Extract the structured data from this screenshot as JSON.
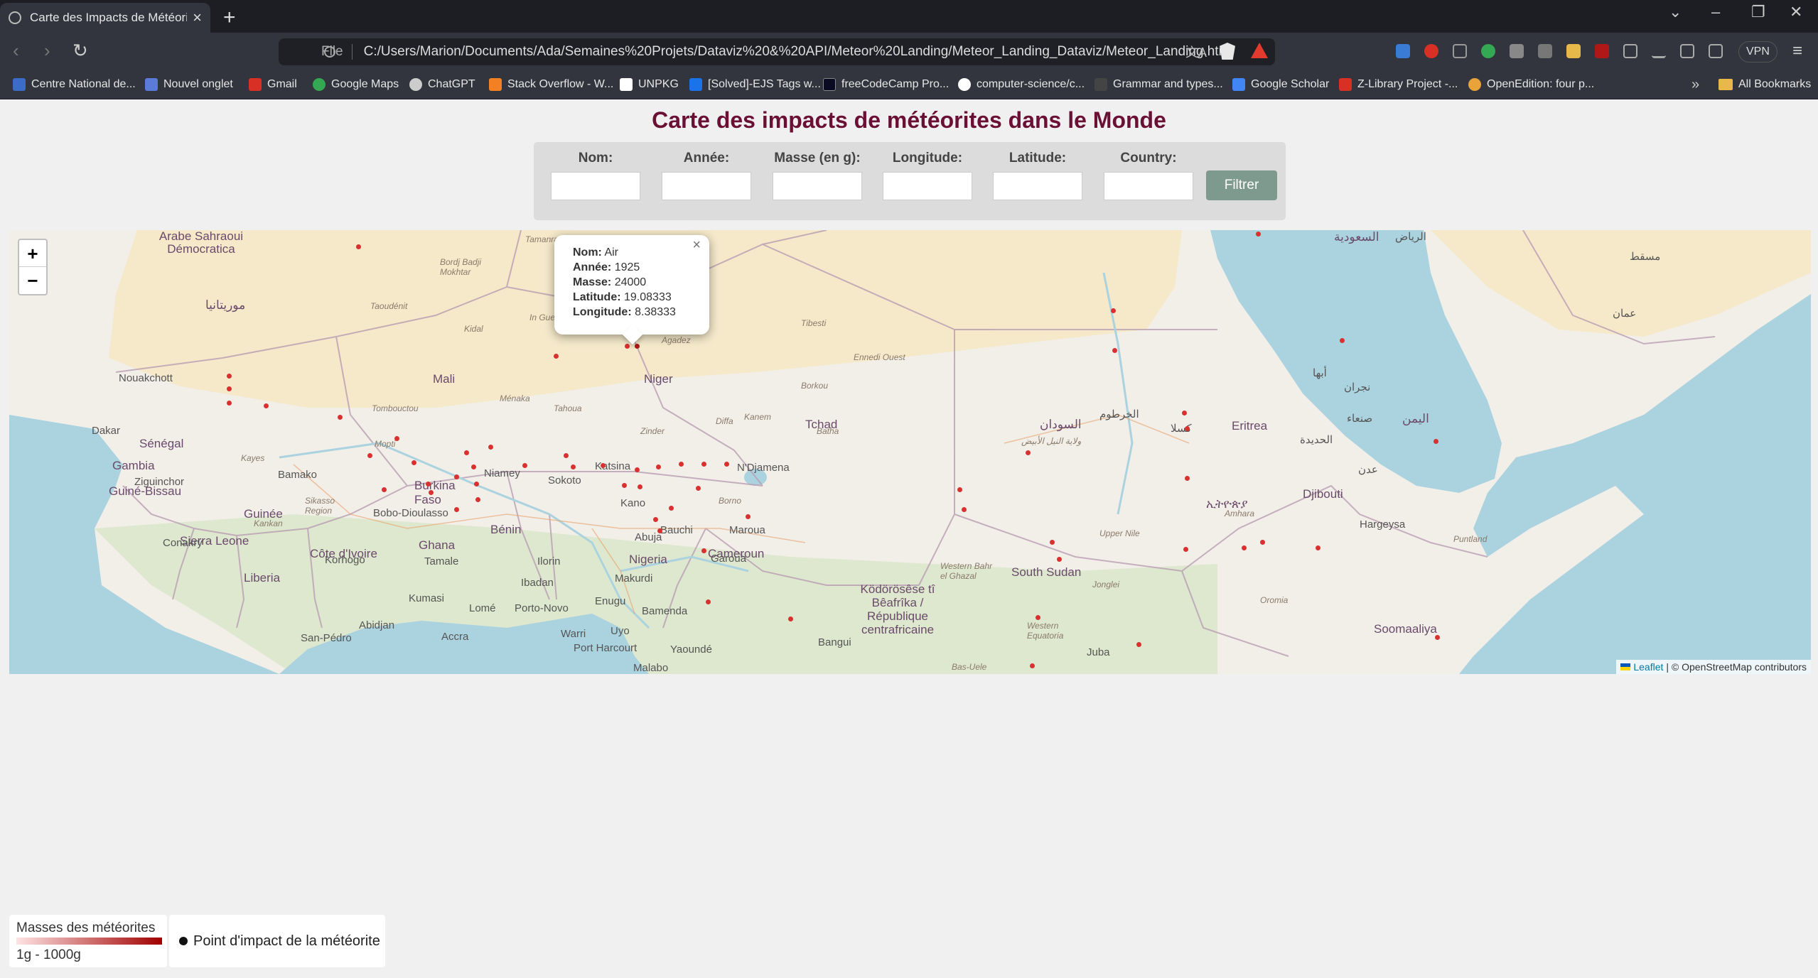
{
  "browser": {
    "tab_title": "Carte des Impacts de Météorite",
    "url_scheme": "File",
    "url": "C:/Users/Marion/Documents/Ada/Semaines%20Projets/Dataviz%20&%20API/Meteor%20Landing/Meteor_Landing_Dataviz/Meteor_Landing.html",
    "vpn_label": "VPN",
    "bookmarks": [
      {
        "label": "Centre National de...",
        "color": "#3a6cc8"
      },
      {
        "label": "Nouvel onglet",
        "color": "#5a7bd8"
      },
      {
        "label": "Gmail",
        "color": "#d93025"
      },
      {
        "label": "Google Maps",
        "color": "#34a853"
      },
      {
        "label": "ChatGPT",
        "color": "#cccccc"
      },
      {
        "label": "Stack Overflow - W...",
        "color": "#f48024"
      },
      {
        "label": "UNPKG",
        "color": "#ffffff"
      },
      {
        "label": "[Solved]-EJS Tags w...",
        "color": "#1a73e8"
      },
      {
        "label": "freeCodeCamp Pro...",
        "color": "#0a0a23"
      },
      {
        "label": "computer-science/c...",
        "color": "#ffffff"
      },
      {
        "label": "Grammar and types...",
        "color": "#444444"
      },
      {
        "label": "Google Scholar",
        "color": "#4285f4"
      },
      {
        "label": "Z-Library Project -...",
        "color": "#d93025"
      },
      {
        "label": "OpenEdition: four p...",
        "color": "#e8a33a"
      }
    ],
    "all_bookmarks": "All Bookmarks"
  },
  "page": {
    "title": "Carte des impacts de météorites dans le Monde",
    "filters": [
      {
        "label": "Nom:",
        "value": ""
      },
      {
        "label": "Année:",
        "value": ""
      },
      {
        "label": "Masse (en g):",
        "value": ""
      },
      {
        "label": "Longitude:",
        "value": ""
      },
      {
        "label": "Latitude:",
        "value": ""
      },
      {
        "label": "Country:",
        "value": ""
      }
    ],
    "filter_button": "Filtrer"
  },
  "map": {
    "zoom_in": "+",
    "zoom_out": "−",
    "popup": {
      "close": "×",
      "nom_label": "Nom:",
      "nom": "Air",
      "annee_label": "Année:",
      "annee": "1925",
      "masse_label": "Masse:",
      "masse": "24000",
      "latitude_label": "Latitude:",
      "latitude": "19.08333",
      "longitude_label": "Longitude:",
      "longitude": "8.38333"
    },
    "attribution_link": "Leaflet",
    "attribution_text": "| © OpenStreetMap contributors",
    "labels": [
      {
        "text": "Mali",
        "kind": "country"
      },
      {
        "text": "Niger",
        "kind": "country"
      },
      {
        "text": "Tchad",
        "kind": "country"
      },
      {
        "text": "Nigeria",
        "kind": "country"
      },
      {
        "text": "Sénégal",
        "kind": "country"
      },
      {
        "text": "Gambia",
        "kind": "country"
      },
      {
        "text": "Guinée",
        "kind": "country"
      },
      {
        "text": "Guiné-Bissau",
        "kind": "country"
      },
      {
        "text": "Sierra Leone",
        "kind": "country"
      },
      {
        "text": "Liberia",
        "kind": "country"
      },
      {
        "text": "Côte d'Ivoire",
        "kind": "country"
      },
      {
        "text": "Ghana",
        "kind": "country"
      },
      {
        "text": "Burkina Faso",
        "kind": "country"
      },
      {
        "text": "Bénin",
        "kind": "country"
      },
      {
        "text": "Cameroun",
        "kind": "country"
      },
      {
        "text": "Ködörösêse tî Bêafrîka / République centrafricaine",
        "kind": "country"
      },
      {
        "text": "South Sudan",
        "kind": "country"
      },
      {
        "text": "السودان",
        "kind": "country"
      },
      {
        "text": "Eritrea",
        "kind": "country"
      },
      {
        "text": "Djibouti",
        "kind": "country"
      },
      {
        "text": "Soomaaliya",
        "kind": "country"
      },
      {
        "text": "اليمن",
        "kind": "country"
      },
      {
        "text": "Arabe Sahraoui Démocratica",
        "kind": "country"
      },
      {
        "text": "Dakar",
        "kind": "city"
      },
      {
        "text": "Bamako",
        "kind": "city"
      },
      {
        "text": "Niamey",
        "kind": "city"
      },
      {
        "text": "Kano",
        "kind": "city"
      },
      {
        "text": "Katsina",
        "kind": "city"
      },
      {
        "text": "Sokoto",
        "kind": "city"
      },
      {
        "text": "Bauchi",
        "kind": "city"
      },
      {
        "text": "Maroua",
        "kind": "city"
      },
      {
        "text": "Garoua",
        "kind": "city"
      },
      {
        "text": "N'Djamena",
        "kind": "city"
      },
      {
        "text": "Abuja",
        "kind": "city"
      },
      {
        "text": "Makurdi",
        "kind": "city"
      },
      {
        "text": "Enugu",
        "kind": "city"
      },
      {
        "text": "Uyo",
        "kind": "city"
      },
      {
        "text": "Warri",
        "kind": "city"
      },
      {
        "text": "Port Harcourt",
        "kind": "city"
      },
      {
        "text": "Yaoundé",
        "kind": "city"
      },
      {
        "text": "Bamenda",
        "kind": "city"
      },
      {
        "text": "Bangui",
        "kind": "city"
      },
      {
        "text": "Ibadan",
        "kind": "city"
      },
      {
        "text": "Ilorin",
        "kind": "city"
      },
      {
        "text": "Lomé",
        "kind": "city"
      },
      {
        "text": "Porto-Novo",
        "kind": "city"
      },
      {
        "text": "Accra",
        "kind": "city"
      },
      {
        "text": "Kumasi",
        "kind": "city"
      },
      {
        "text": "Tamale",
        "kind": "city"
      },
      {
        "text": "Abidjan",
        "kind": "city"
      },
      {
        "text": "San-Pédro",
        "kind": "city"
      },
      {
        "text": "Korhogo",
        "kind": "city"
      },
      {
        "text": "Bobo-Dioulasso",
        "kind": "city"
      },
      {
        "text": "Conakry",
        "kind": "city"
      },
      {
        "text": "Ziguinchor",
        "kind": "city"
      },
      {
        "text": "Tombouctou",
        "kind": "city"
      },
      {
        "text": "Agadez",
        "kind": "city"
      },
      {
        "text": "Tahoua",
        "kind": "city"
      },
      {
        "text": "Ménaka",
        "kind": "city"
      },
      {
        "text": "Zinder",
        "kind": "city"
      },
      {
        "text": "Diffa",
        "kind": "city"
      },
      {
        "text": "Kidal",
        "kind": "city"
      },
      {
        "text": "Taoudénit",
        "kind": "city"
      },
      {
        "text": "Tamanrasset",
        "kind": "city"
      },
      {
        "text": "Juba",
        "kind": "city"
      },
      {
        "text": "Hargeysa",
        "kind": "city"
      },
      {
        "text": "الخرطوم",
        "kind": "city"
      },
      {
        "text": "كسلا",
        "kind": "city"
      },
      {
        "text": "صنعاء",
        "kind": "city"
      },
      {
        "text": "عدن",
        "kind": "city"
      },
      {
        "text": "الرياض",
        "kind": "city"
      },
      {
        "text": "مسقط",
        "kind": "city"
      },
      {
        "text": "عمان",
        "kind": "city"
      },
      {
        "text": "السعودية",
        "kind": "country"
      },
      {
        "text": "أبها",
        "kind": "city"
      },
      {
        "text": "نجران",
        "kind": "city"
      },
      {
        "text": "الحديدة",
        "kind": "city"
      },
      {
        "text": "Tibesti",
        "kind": "region"
      },
      {
        "text": "Ennedi Ouest",
        "kind": "region"
      },
      {
        "text": "Borkou",
        "kind": "region"
      },
      {
        "text": "Kanem",
        "kind": "region"
      },
      {
        "text": "Batha",
        "kind": "region"
      },
      {
        "text": "Bordj Badji Mokhtar",
        "kind": "region"
      },
      {
        "text": "In Guezzam",
        "kind": "region"
      },
      {
        "text": "Western Bahr el Ghazal",
        "kind": "region"
      },
      {
        "text": "Upper Nile",
        "kind": "region"
      },
      {
        "text": "Western Equatoria",
        "kind": "region"
      },
      {
        "text": "Jonglei",
        "kind": "region"
      },
      {
        "text": "Puntland",
        "kind": "region"
      },
      {
        "text": "Amhara",
        "kind": "region"
      },
      {
        "text": "Oromia",
        "kind": "region"
      },
      {
        "text": "Mopti",
        "kind": "region"
      },
      {
        "text": "Kayes",
        "kind": "region"
      },
      {
        "text": "Sikasso Region",
        "kind": "region"
      },
      {
        "text": "Kankan",
        "kind": "region"
      },
      {
        "text": "Borno",
        "kind": "region"
      },
      {
        "text": "Bas-Uele",
        "kind": "region"
      },
      {
        "text": "Malabo",
        "kind": "city"
      },
      {
        "text": "Nouakchott",
        "kind": "city"
      },
      {
        "text": "موريتانيا",
        "kind": "country"
      },
      {
        "text": "ولاية النيل الأبيض",
        "kind": "region"
      },
      {
        "text": "ኢትዮጵያ",
        "kind": "country"
      }
    ]
  },
  "legend": {
    "mass_title": "Masses des météorites",
    "mass_range": "1g - 1000g",
    "point_label": "Point d'impact de la météorite"
  },
  "colors": {
    "title": "#6b1035",
    "dot": "#d93030",
    "filter_button": "#7e9a8e"
  }
}
